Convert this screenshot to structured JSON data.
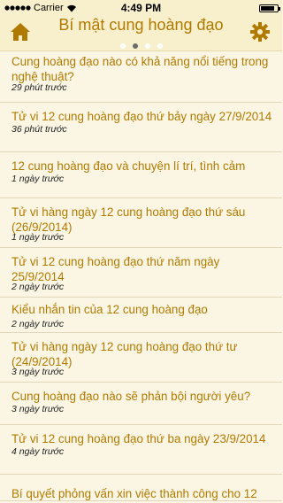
{
  "status_bar": {
    "carrier": "Carrier",
    "time": "4:49 PM"
  },
  "header": {
    "title": "Bí mật cung hoàng đạo",
    "page_dots": 4,
    "active_dot": 1
  },
  "articles": [
    {
      "title": "Cung hoàng đạo nào có khả năng nổi tiếng trong nghệ thuật?",
      "time": "29 phút trước"
    },
    {
      "title": "Tử vi 12 cung hoàng đạo thứ bảy ngày 27/9/2014",
      "time": "36 phút trước"
    },
    {
      "title": "12 cung hoàng đạo và chuyện lí trí, tình cảm",
      "time": "1 ngày trước"
    },
    {
      "title": "Tử vi hàng ngày 12 cung hoàng đạo thứ sáu (26/9/2014)",
      "time": "1 ngày trước"
    },
    {
      "title": "Tử vi 12 cung hoàng đạo thứ năm ngày 25/9/2014",
      "time": "2 ngày trước"
    },
    {
      "title": "Kiểu nhắn tin của 12 cung hoàng đạo",
      "time": "2 ngày trước"
    },
    {
      "title": "Tử vi hàng ngày 12 cung hoàng đạo thứ tư (24/9/2014)",
      "time": "3 ngày trước"
    },
    {
      "title": "Cung hoàng đạo nào sẽ phản bội người yêu?",
      "time": "3 ngày trước"
    },
    {
      "title": "Tử vi 12 cung hoàng đạo thứ ba ngày 23/9/2014",
      "time": "4 ngày trước"
    },
    {
      "title": "Bí quyết phỏng vấn xin việc thành công cho 12",
      "time": ""
    }
  ],
  "colors": {
    "accent": "#b07a00",
    "header_bg": "#f8f0cc",
    "page_bg": "#fbf6e4"
  }
}
